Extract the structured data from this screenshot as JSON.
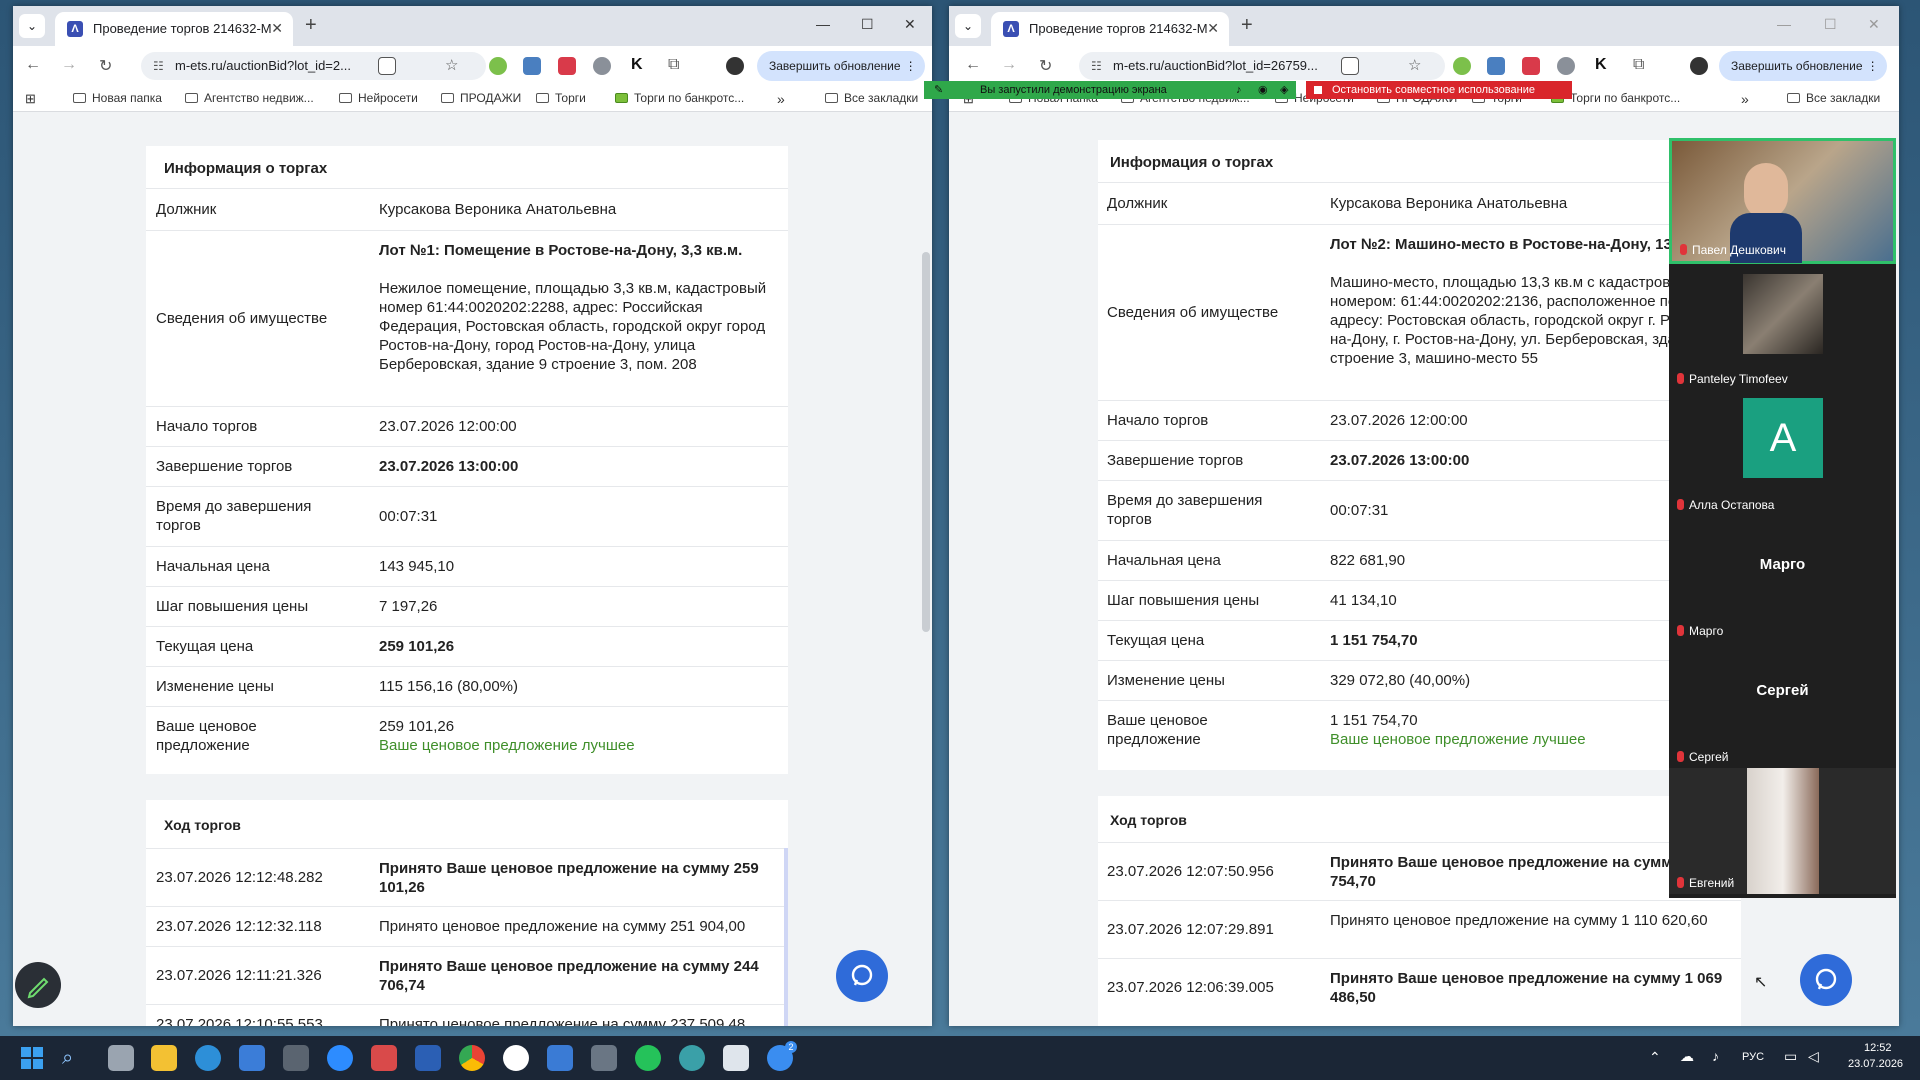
{
  "left_window": {
    "tab_title": "Проведение торгов 214632-М",
    "url": "m-ets.ru/auctionBid?lot_id=2...",
    "update_button": "Завершить обновление",
    "bookmarks": [
      "Новая папка",
      "Агентство недвиж...",
      "Нейросети",
      "ПРОДАЖИ",
      "Торги",
      "Торги по банкротс..."
    ],
    "all_bookmarks": "Все закладки",
    "info": {
      "title": "Информация о торгах",
      "debtor_label": "Должник",
      "debtor": "Курсакова Вероника Анатольевна",
      "property_label": "Сведения об имуществе",
      "lot_title": "Лот №1: Помещение в Ростове-на-Дону, 3,3 кв.м.",
      "lot_desc": "Нежилое помещение, площадью 3,3 кв.м, кадастровый номер 61:44:0020202:2288, адрес: Российская Федерация, Ростовская область, городской округ город Ростов-на-Дону, город Ростов-на-Дону, улица Берберовская, здание 9 строение 3, пом. 208",
      "start_label": "Начало торгов",
      "start": "23.07.2026 12:00:00",
      "end_label": "Завершение торгов",
      "end": "23.07.2026 13:00:00",
      "remaining_label": "Время до завершения торгов",
      "remaining": "00:07:31",
      "initial_price_label": "Начальная цена",
      "initial_price": "143 945,10",
      "step_label": "Шаг повышения цены",
      "step": "7 197,26",
      "current_price_label": "Текущая цена",
      "current_price": "259 101,26",
      "change_label": "Изменение цены",
      "change": "115 156,16 (80,00%)",
      "your_bid_label": "Ваше ценовое предложение",
      "your_bid": "259 101,26",
      "your_bid_status": "Ваше ценовое предложение лучшее"
    },
    "history_title": "Ход торгов",
    "history": [
      {
        "time": "23.07.2026 12:12:48.282",
        "text": "Принято Ваше ценовое предложение на сумму 259 101,26"
      },
      {
        "time": "23.07.2026 12:12:32.118",
        "text": "Принято ценовое предложение на сумму 251 904,00"
      },
      {
        "time": "23.07.2026 12:11:21.326",
        "text": "Принято Ваше ценовое предложение на сумму 244 706,74"
      },
      {
        "time": "23.07.2026 12:10:55.553",
        "text": "Принято ценовое предложение на сумму 237 509,48"
      }
    ]
  },
  "right_window": {
    "tab_title": "Проведение торгов 214632-М",
    "url": "m-ets.ru/auctionBid?lot_id=26759...",
    "update_button": "Завершить обновление",
    "bookmarks": [
      "Новая папка",
      "Агентство недвиж...",
      "Нейросети",
      "ПРОДАЖИ",
      "Торги",
      "Торги по банкротс..."
    ],
    "all_bookmarks": "Все закладки",
    "info": {
      "title": "Информация о торгах",
      "debtor_label": "Должник",
      "debtor": "Курсакова Вероника Анатольевна",
      "property_label": "Сведения об имуществе",
      "lot_title": "Лот №2: Машино-место в Ростове-на-Дону, 13,3 кв.м.",
      "lot_desc": "Машино-место, площадью 13,3 кв.м с кадастровым номером: 61:44:0020202:2136, расположенное по адресу: Ростовская область, городской округ г. Ростов-на-Дону, г. Ростов-на-Дону, ул. Берберовская, здание 9 строение 3, машино-место 55",
      "start_label": "Начало торгов",
      "start": "23.07.2026 12:00:00",
      "end_label": "Завершение торгов",
      "end": "23.07.2026 13:00:00",
      "remaining_label": "Время до завершения торгов",
      "remaining": "00:07:31",
      "initial_price_label": "Начальная цена",
      "initial_price": "822 681,90",
      "step_label": "Шаг повышения цены",
      "step": "41 134,10",
      "current_price_label": "Текущая цена",
      "current_price": "1 151 754,70",
      "change_label": "Изменение цены",
      "change": "329 072,80 (40,00%)",
      "your_bid_label": "Ваше ценовое предложение",
      "your_bid": "1 151 754,70",
      "your_bid_status": "Ваше ценовое предложение лучшее"
    },
    "history_title": "Ход торгов",
    "history": [
      {
        "time": "23.07.2026 12:07:50.956",
        "text": "Принято Ваше ценовое предложение на сумму 1 151 754,70"
      },
      {
        "time": "23.07.2026 12:07:29.891",
        "text": "Принято ценовое предложение на сумму 1 110 620,60"
      },
      {
        "time": "23.07.2026 12:06:39.005",
        "text": "Принято Ваше ценовое предложение на сумму 1 069 486,50"
      }
    ]
  },
  "share_bar": {
    "notice": "Вы запустили демонстрацию экрана",
    "stop": "Остановить совместное использование"
  },
  "participants": [
    {
      "name": "Павел Дешкович",
      "tile": "video"
    },
    {
      "name": "Panteley Timofeev",
      "tile": "photo"
    },
    {
      "name": "Алла Остапова",
      "tile": "avatar",
      "initial": "A"
    },
    {
      "name": "Марго",
      "tile": "name",
      "big": "Марго"
    },
    {
      "name": "Сергей",
      "tile": "name",
      "big": "Сергей"
    },
    {
      "name": "Евгений",
      "tile": "video"
    }
  ],
  "taskbar": {
    "lang": "РУС",
    "time": "12:52",
    "date": "23.07.2026",
    "badge": "2"
  },
  "colors": {
    "accent": "#2f6bd9",
    "best_bid": "#3f8f2a",
    "share_green": "#2fa84a",
    "share_red": "#d9252b"
  }
}
